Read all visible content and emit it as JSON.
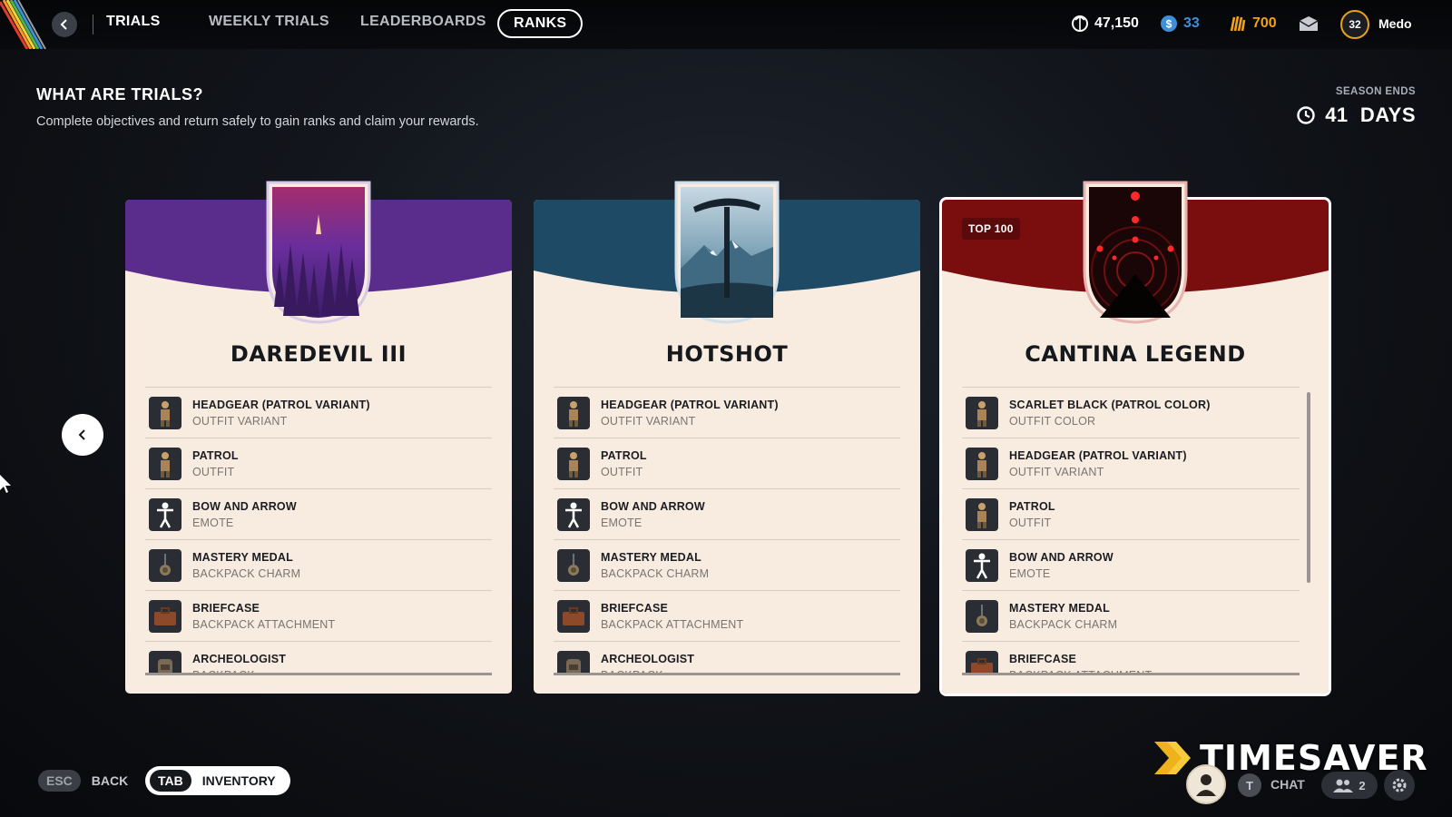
{
  "nav": {
    "tabs": [
      "TRIALS",
      "WEEKLY TRIALS",
      "LEADERBOARDS",
      "RANKS"
    ],
    "active_tab": "RANKS"
  },
  "currencies": [
    {
      "icon": "credits-icon",
      "value": "47,150",
      "color": "#ffffff"
    },
    {
      "icon": "coin-icon",
      "value": "33",
      "color": "#3f8fd8"
    },
    {
      "icon": "gold-medallion-icon",
      "value": "700",
      "color": "#f0a21c"
    }
  ],
  "user": {
    "level": "32",
    "name": "Medo"
  },
  "header": {
    "title": "WHAT ARE TRIALS?",
    "subtitle": "Complete objectives and return safely to gain ranks and claim your rewards.",
    "season_label": "SEASON ENDS",
    "season_value": "41  DAYS"
  },
  "cards": [
    {
      "title": "DAREDEVIL III",
      "accent": "#5a2d8c",
      "tag": "",
      "rewards": [
        {
          "name": "HEADGEAR (PATROL VARIANT)",
          "type": "OUTFIT VARIANT",
          "icon": "outfit-icon"
        },
        {
          "name": "PATROL",
          "type": "OUTFIT",
          "icon": "outfit-icon"
        },
        {
          "name": "BOW AND ARROW",
          "type": "EMOTE",
          "icon": "emote-icon"
        },
        {
          "name": "MASTERY MEDAL",
          "type": "BACKPACK CHARM",
          "icon": "medal-icon"
        },
        {
          "name": "BRIEFCASE",
          "type": "BACKPACK ATTACHMENT",
          "icon": "briefcase-icon"
        },
        {
          "name": "ARCHEOLOGIST",
          "type": "BACKPACK",
          "icon": "backpack-icon"
        }
      ]
    },
    {
      "title": "HOTSHOT",
      "accent": "#1f4a66",
      "tag": "",
      "rewards": [
        {
          "name": "HEADGEAR (PATROL VARIANT)",
          "type": "OUTFIT VARIANT",
          "icon": "outfit-icon"
        },
        {
          "name": "PATROL",
          "type": "OUTFIT",
          "icon": "outfit-icon"
        },
        {
          "name": "BOW AND ARROW",
          "type": "EMOTE",
          "icon": "emote-icon"
        },
        {
          "name": "MASTERY MEDAL",
          "type": "BACKPACK CHARM",
          "icon": "medal-icon"
        },
        {
          "name": "BRIEFCASE",
          "type": "BACKPACK ATTACHMENT",
          "icon": "briefcase-icon"
        },
        {
          "name": "ARCHEOLOGIST",
          "type": "BACKPACK",
          "icon": "backpack-icon"
        }
      ]
    },
    {
      "title": "CANTINA LEGEND",
      "accent": "#7a0d0d",
      "tag": "TOP 100",
      "rewards": [
        {
          "name": "SCARLET BLACK (PATROL COLOR)",
          "type": "OUTFIT COLOR",
          "icon": "outfit-icon"
        },
        {
          "name": "HEADGEAR (PATROL VARIANT)",
          "type": "OUTFIT VARIANT",
          "icon": "outfit-icon"
        },
        {
          "name": "PATROL",
          "type": "OUTFIT",
          "icon": "outfit-icon"
        },
        {
          "name": "BOW AND ARROW",
          "type": "EMOTE",
          "icon": "emote-icon"
        },
        {
          "name": "MASTERY MEDAL",
          "type": "BACKPACK CHARM",
          "icon": "medal-icon"
        },
        {
          "name": "BRIEFCASE",
          "type": "BACKPACK ATTACHMENT",
          "icon": "briefcase-icon"
        }
      ]
    }
  ],
  "footer": {
    "back_key": "ESC",
    "back_label": "BACK",
    "inventory_key": "TAB",
    "inventory_label": "INVENTORY",
    "chat_key": "T",
    "chat_label": "CHAT",
    "friends_count": "2"
  },
  "watermark": "TIMESAVER"
}
